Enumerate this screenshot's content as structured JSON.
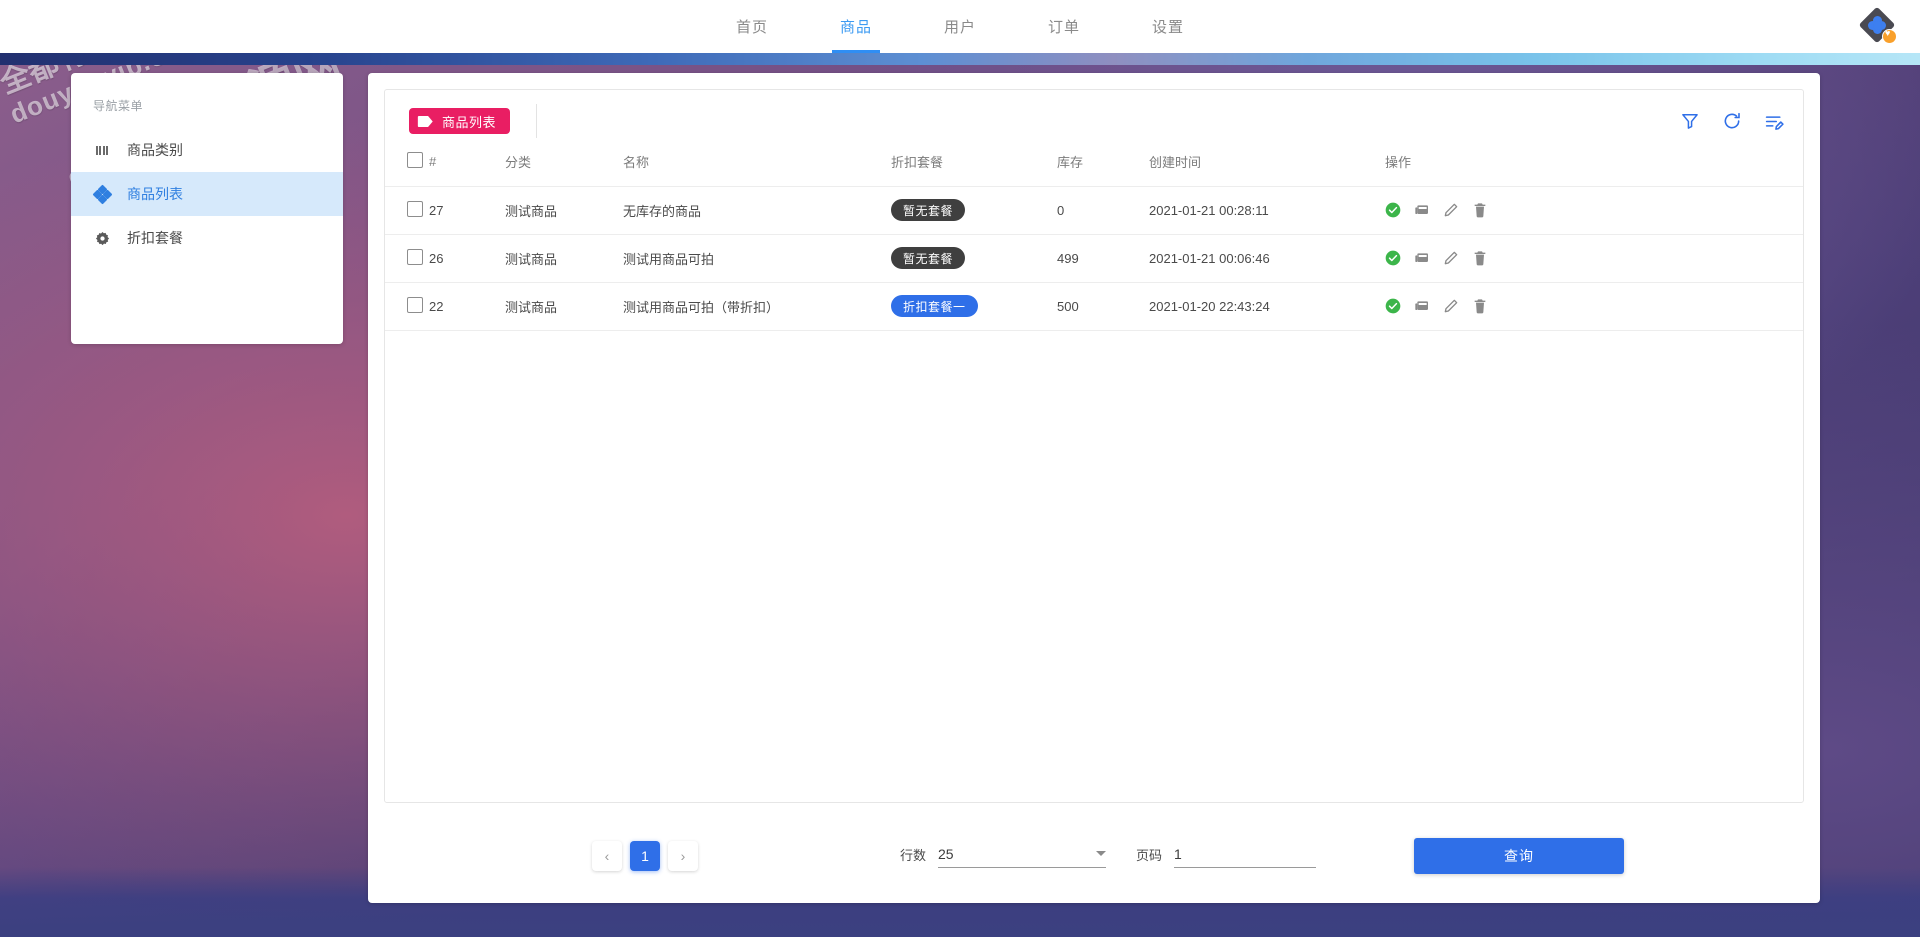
{
  "wallpaper": {
    "watermark_lines": [
      "全都有资源网",
      "douyouvip.com",
      "全都有资源网",
      "douyouvip.com"
    ]
  },
  "header": {
    "nav": [
      {
        "label": "首页",
        "active": false
      },
      {
        "label": "商品",
        "active": true
      },
      {
        "label": "用户",
        "active": false
      },
      {
        "label": "订单",
        "active": false
      },
      {
        "label": "设置",
        "active": false
      }
    ],
    "logo_name": "app-logo"
  },
  "sidebar": {
    "title": "导航菜单",
    "items": [
      {
        "label": "商品类别",
        "icon": "grid-icon",
        "active": false
      },
      {
        "label": "商品列表",
        "icon": "diamond-cluster-icon",
        "active": true
      },
      {
        "label": "折扣套餐",
        "icon": "gear-icon",
        "active": false
      }
    ]
  },
  "panel": {
    "badge": "商品列表",
    "tools": [
      {
        "name": "filter-icon",
        "title": "筛选"
      },
      {
        "name": "refresh-icon",
        "title": "刷新"
      },
      {
        "name": "edit-list-icon",
        "title": "编辑列"
      }
    ]
  },
  "table": {
    "columns": [
      "#",
      "分类",
      "名称",
      "折扣套餐",
      "库存",
      "创建时间",
      "操作"
    ],
    "rows": [
      {
        "id": "27",
        "category": "测试商品",
        "name": "无库存的商品",
        "combo": "暂无套餐",
        "combo_style": "dark",
        "stock": "0",
        "created": "2021-01-21 00:28:11"
      },
      {
        "id": "26",
        "category": "测试商品",
        "name": "测试用商品可拍",
        "combo": "暂无套餐",
        "combo_style": "dark",
        "stock": "499",
        "created": "2021-01-21 00:06:46"
      },
      {
        "id": "22",
        "category": "测试商品",
        "name": "测试用商品可拍（带折扣）",
        "combo": "折扣套餐一",
        "combo_style": "blue",
        "stock": "500",
        "created": "2021-01-20 22:43:24"
      }
    ],
    "row_actions": [
      "enable-icon",
      "card-icon",
      "edit-icon",
      "delete-icon"
    ]
  },
  "footer": {
    "prev_label": "‹",
    "next_label": "›",
    "current_page": "1",
    "rows_label": "行数",
    "rows_value": "25",
    "page_label": "页码",
    "page_value": "1",
    "query_label": "查询"
  },
  "colors": {
    "accent_blue": "#2f6fe8",
    "badge_pink": "#e91e63",
    "pill_dark": "#3f3f3f",
    "active_nav": "#3d9bf2",
    "sidebar_active_bg": "#d6e9fb",
    "success_green": "#3cb54a"
  }
}
